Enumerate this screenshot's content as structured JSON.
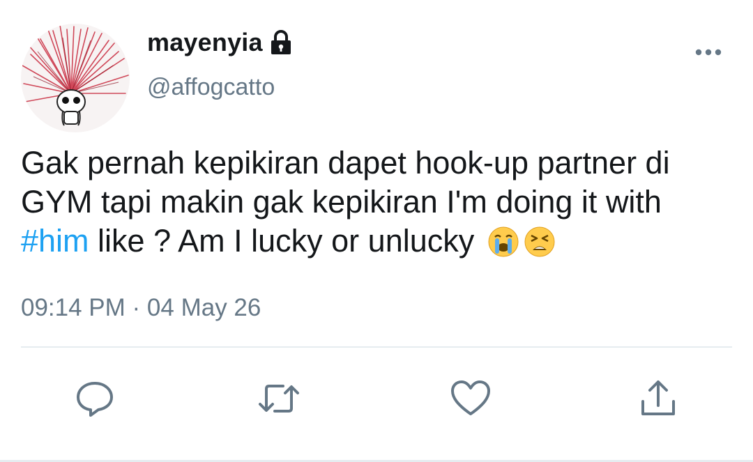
{
  "user": {
    "display_name": "mayenyia",
    "handle": "@affogcatto",
    "verified_icon": "lock-icon"
  },
  "tweet": {
    "text_line1": "Gak pernah kepikiran dapet hook-up partner di",
    "text_line2": "GYM tapi makin gak kepikiran I'm doing it with",
    "hashtag": "#him",
    "text_line3_rest": " like ? Am I lucky or unlucky ",
    "emojis": [
      "loudly-crying-face-emoji",
      "tired-face-emoji"
    ],
    "timestamp": "09:14 PM · 04 May 26"
  },
  "actions": {
    "icons": [
      "reply-icon",
      "retweet-icon",
      "like-icon",
      "share-icon"
    ]
  },
  "colors": {
    "text": "#14171a",
    "secondary": "#657786",
    "link": "#1da1f2",
    "divider": "#e6ecf0"
  }
}
